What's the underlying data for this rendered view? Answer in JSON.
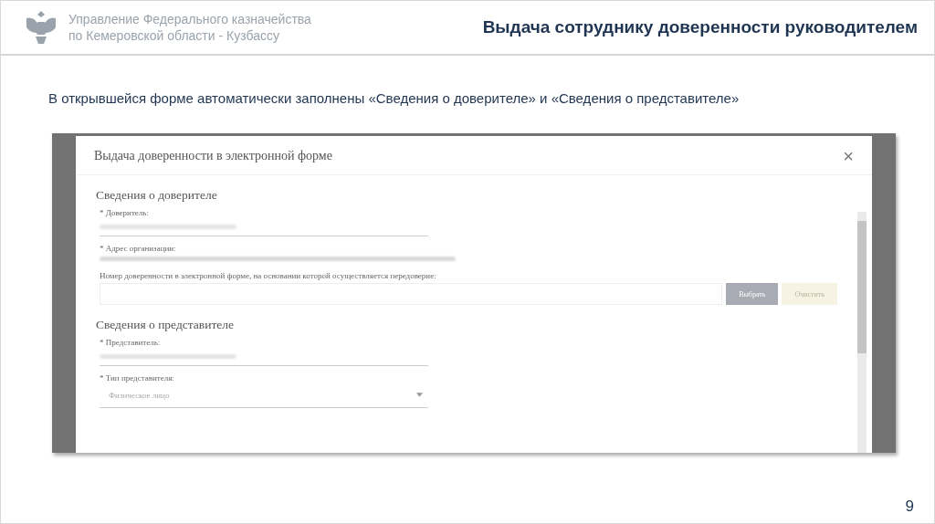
{
  "header": {
    "organization_lines": [
      "Управление Федерального казначейства",
      "по Кемеровской области - Кузбассу"
    ],
    "title": "Выдача сотруднику доверенности руководителем"
  },
  "subtitle": "В открывшейся форме автоматически заполнены «Сведения о доверителе» и «Сведения о представителе»",
  "modal": {
    "title": "Выдача доверенности в электронной форме",
    "close": "×",
    "sections": [
      {
        "heading": "Сведения о доверителе",
        "fields": [
          {
            "kind": "underline",
            "label": "* Доверитель:",
            "redacted": true
          },
          {
            "kind": "plain",
            "label": "* Адрес организации:",
            "redacted": true
          },
          {
            "kind": "picker",
            "label": "Номер доверенности в электронной форме, на основании которой осуществляется передоверие:",
            "buttons": [
              {
                "label": "Выбрать",
                "kind": "primary"
              },
              {
                "label": "Очистить",
                "kind": "secondary"
              }
            ]
          }
        ]
      },
      {
        "heading": "Сведения о представителе",
        "fields": [
          {
            "kind": "underline",
            "label": "* Представитель:",
            "redacted": true
          },
          {
            "kind": "select",
            "label": "* Тип представителя:",
            "value": "Физическое лицо"
          }
        ]
      }
    ]
  },
  "page_number": "9"
}
